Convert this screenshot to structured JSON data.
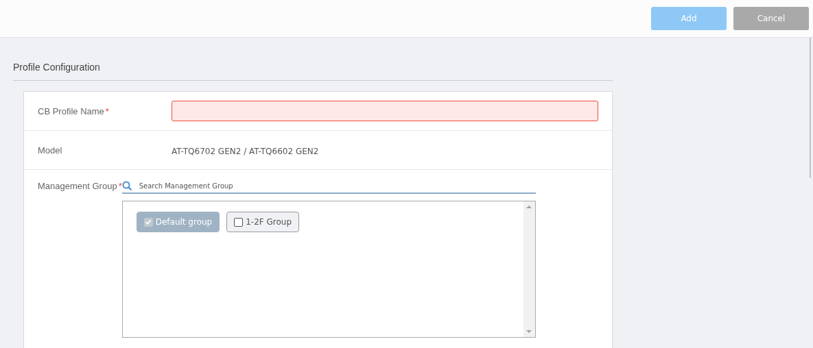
{
  "toolbar": {
    "buttons": [
      {
        "label": "Add",
        "kind": "primary",
        "disabled": true
      },
      {
        "label": "Cancel",
        "kind": "secondary",
        "disabled": false
      }
    ]
  },
  "section": {
    "title": "Profile Configuration"
  },
  "fields": [
    {
      "label": "CB Profile Name",
      "required_mark": "*",
      "kind": "input",
      "invalid": true
    },
    {
      "label": "Model",
      "kind": "text",
      "value": "AT-TQ6702 GEN2 / AT-TQ6602 GEN2"
    },
    {
      "label": "Management Group",
      "required_mark": "*",
      "kind": "groups",
      "search_placeholder": "Search Management Group",
      "groups": [
        {
          "label": "Default group",
          "checked": true
        },
        {
          "label": "1-2F Group",
          "checked": false
        }
      ]
    }
  ]
}
